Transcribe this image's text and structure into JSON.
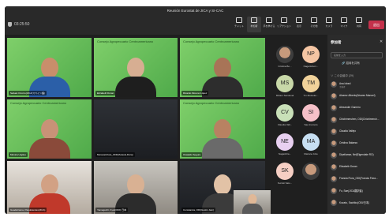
{
  "meeting": {
    "title": "Reunión Eurostat de JICA y SI-CAC",
    "timer": "03:25:50",
    "leave_label": "退出"
  },
  "toolbar": [
    {
      "key": "chat",
      "label": "チャット"
    },
    {
      "key": "people",
      "label": "参加者"
    },
    {
      "key": "raise",
      "label": "手を挙げる"
    },
    {
      "key": "react",
      "label": "リアクション"
    },
    {
      "key": "view",
      "label": "表示"
    },
    {
      "key": "more",
      "label": "その他"
    },
    {
      "key": "camera",
      "label": "カメラ"
    },
    {
      "key": "mic",
      "label": "マイク"
    },
    {
      "key": "share",
      "label": "共有"
    }
  ],
  "tiles": [
    {
      "name": "Sebast Orozco(JICA/スペイン語)",
      "bg": "green",
      "brand": "",
      "skin": "#c98e6b",
      "shirt": "#2b5fa8"
    },
    {
      "name": "Elizabeth Duran",
      "bg": "green",
      "brand": "Consejo Agropecuario Centroamericano",
      "skin": "#d7ae92",
      "shirt": "#1e1e1e"
    },
    {
      "name": "Ricardo Moreno López",
      "bg": "green",
      "brand": "Consejo Agropecuario Centroamericano",
      "skin": "#a87457",
      "shirt": "#2d2d2d"
    },
    {
      "name": "Mónica Urgiles",
      "bg": "green",
      "brand": "Consejo Agropecuario Centroamericano",
      "skin": "#c99277",
      "shirt": "#8a4a3a"
    },
    {
      "name": "Muracal,Flora_ODI(Muracal,Flora)",
      "bg": "dark",
      "brand": "",
      "skin": "",
      "shirt": ""
    },
    {
      "name": "Oswaldo Segura",
      "bg": "green",
      "brand": "Consejo Agropecuario Centroamericano",
      "skin": "#b88262",
      "shirt": "#6a6a6a"
    },
    {
      "name": "Guadarrama, Paquistentes(JICA)",
      "bg": "room",
      "brand": "",
      "skin": "#d2a184",
      "shirt": "#c0392b"
    },
    {
      "name": "Yamaguchi, Kyoji(ODI) 日本",
      "bg": "office",
      "brand": "",
      "skin": "#d9b193",
      "shirt": "#2c2c2c"
    },
    {
      "name": "Constancia, ODI(Gustin Jam)",
      "bg": "dark",
      "brand": "",
      "skin": "#e2c2a6",
      "shirt": "#3b3b3b"
    },
    {
      "name": "",
      "bg": "office",
      "brand": "",
      "skin": "#e0b897",
      "shirt": "#5a5a5a"
    }
  ],
  "roster": [
    {
      "initials": "",
      "label": "Cristina Bo...",
      "color": ""
    },
    {
      "initials": "NP",
      "label": "Nagarishum...",
      "color": "#f4c5a3"
    },
    {
      "initials": "MS",
      "label": "Miriam Sandoval",
      "color": "#c8d8a8"
    },
    {
      "initials": "TM",
      "label": "Tm Mutsuko...",
      "color": "#f0d29a"
    },
    {
      "initials": "CV",
      "label": "Claudia Vall...",
      "color": "#c9e0b8"
    },
    {
      "initials": "SI",
      "label": "Sae Inamoto",
      "color": "#f5c0c8"
    },
    {
      "initials": "NE",
      "label": "Nagashira...",
      "color": "#e8d0f0"
    },
    {
      "initials": "MA",
      "label": "Mariano Atze",
      "color": "#c7dff2"
    },
    {
      "initials": "SK",
      "label": "Suzuki Sato...",
      "color": "#f6cfc4"
    },
    {
      "initials": "",
      "label": "",
      "color": ""
    }
  ],
  "panel": {
    "header": "参加者",
    "close": "✕",
    "search_placeholder": "名前を入力",
    "share_label": "🔗 招待を共有",
    "section": "∨ この会議中 (29)",
    "people": [
      {
        "name": "Ana Ixbed",
        "sub": "主催者"
      },
      {
        "name": "Alvarez Alberto(Alvarez Manuel)",
        "sub": ""
      },
      {
        "name": "Alexander Gamero",
        "sub": ""
      },
      {
        "name": "Chichimeruhen, ODI(Chichimeruh...",
        "sub": ""
      },
      {
        "name": "Claudia Vallejo",
        "sub": ""
      },
      {
        "name": "Cristina Balaezo",
        "sub": ""
      },
      {
        "name": "Dipellamar, Nel(Eigendaie RO)",
        "sub": ""
      },
      {
        "name": "Elizabeth Duran",
        "sub": ""
      },
      {
        "name": "Francia Flora_ODI(Francia Flora...",
        "sub": ""
      },
      {
        "name": "Fu, Sae(JICA翻訳者)",
        "sub": ""
      },
      {
        "name": "Kozato, Sachiko(ODI/日本)",
        "sub": ""
      }
    ]
  }
}
